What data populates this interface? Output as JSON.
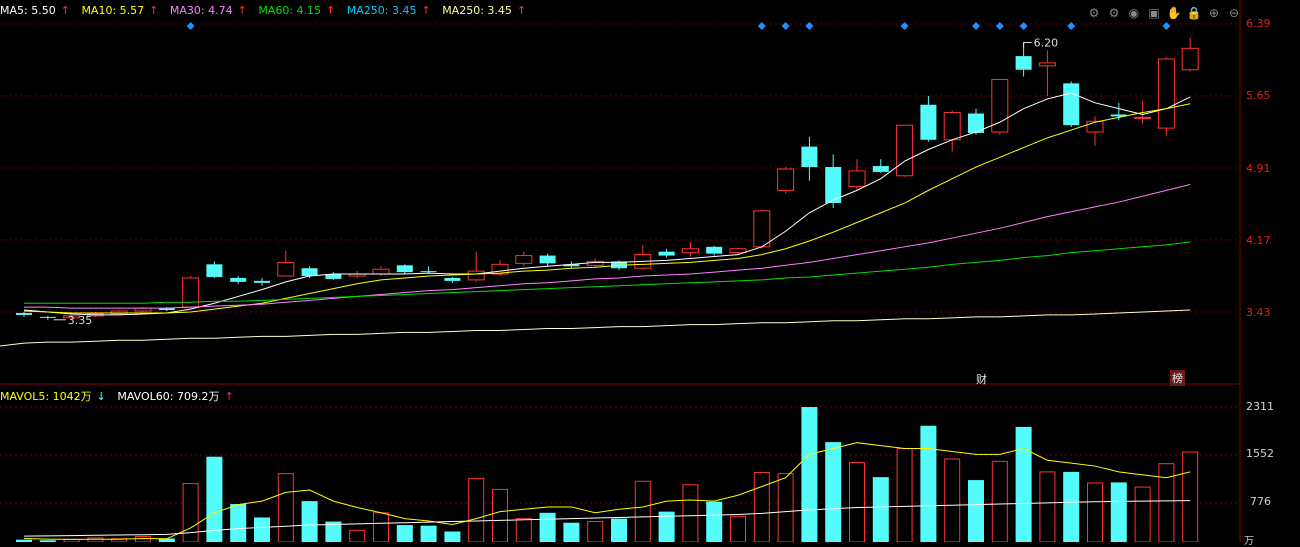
{
  "legend": {
    "ma5": {
      "label": "MA5: 5.50",
      "arrow": "↑",
      "color": "#ffffff"
    },
    "ma10": {
      "label": "MA10: 5.57",
      "arrow": "↑",
      "color": "#ffff00"
    },
    "ma30": {
      "label": "MA30: 4.74",
      "arrow": "↑",
      "color": "#ff80ff"
    },
    "ma60": {
      "label": "MA60: 4.15",
      "arrow": "↑",
      "color": "#00e000"
    },
    "ma250a": {
      "label": "MA250: 3.45",
      "arrow": "↑",
      "color": "#00ccff"
    },
    "ma250b": {
      "label": "MA250: 3.45",
      "arrow": "↑",
      "color": "#ffff99"
    }
  },
  "vol_legend": {
    "mavol5": {
      "label": "MAVOL5: 1042万",
      "arrow": "↓",
      "color": "#ffff00"
    },
    "mavol60": {
      "label": "MAVOL60: 709.2万",
      "arrow": "↑",
      "color": "#ffffff"
    }
  },
  "toolbar": [
    "gear-icon",
    "settings-icon",
    "eye-icon",
    "briefcase-icon",
    "hand-icon",
    "lock-icon",
    "zoom-in-icon",
    "zoom-out-icon"
  ],
  "toolbar_glyphs": [
    "⚙",
    "⚙",
    "◉",
    "▣",
    "✋",
    "🔒",
    "⊕",
    "⊖"
  ],
  "price_axis": [
    "6.39",
    "5.65",
    "4.91",
    "4.17",
    "3.43"
  ],
  "vol_axis": [
    "2311",
    "1552",
    "776"
  ],
  "annotations": {
    "high": "6.20",
    "low": "3.35",
    "cai": "财",
    "bang": "榜",
    "vol_unit": "万"
  },
  "colors": {
    "up": "#ff3232",
    "down": "#54fcfc",
    "grid": "#7a0000",
    "text": "#e0201e",
    "marker": "#1e90ff"
  },
  "chart_data": {
    "type": "candlestick",
    "price_range": [
      3.0,
      6.45
    ],
    "volume_range": [
      0,
      2400
    ],
    "candles": [
      {
        "o": 3.42,
        "c": 3.4,
        "h": 3.43,
        "l": 3.38,
        "v": 40,
        "up": false
      },
      {
        "o": 3.38,
        "c": 3.37,
        "h": 3.39,
        "l": 3.35,
        "v": 30,
        "up": false
      },
      {
        "o": 3.37,
        "c": 3.39,
        "h": 3.4,
        "l": 3.36,
        "v": 45,
        "up": true
      },
      {
        "o": 3.39,
        "c": 3.41,
        "h": 3.43,
        "l": 3.38,
        "v": 70,
        "up": true
      },
      {
        "o": 3.41,
        "c": 3.44,
        "h": 3.45,
        "l": 3.4,
        "v": 55,
        "up": true
      },
      {
        "o": 3.44,
        "c": 3.47,
        "h": 3.48,
        "l": 3.43,
        "v": 95,
        "up": true
      },
      {
        "o": 3.47,
        "c": 3.45,
        "h": 3.48,
        "l": 3.44,
        "v": 60,
        "up": false
      },
      {
        "o": 3.48,
        "c": 3.78,
        "h": 3.8,
        "l": 3.46,
        "v": 1000,
        "up": true
      },
      {
        "o": 3.92,
        "c": 3.79,
        "h": 3.95,
        "l": 3.78,
        "v": 1460,
        "up": false
      },
      {
        "o": 3.78,
        "c": 3.74,
        "h": 3.8,
        "l": 3.72,
        "v": 650,
        "up": false
      },
      {
        "o": 3.75,
        "c": 3.73,
        "h": 3.78,
        "l": 3.7,
        "v": 420,
        "up": false
      },
      {
        "o": 3.8,
        "c": 3.94,
        "h": 4.06,
        "l": 3.8,
        "v": 1170,
        "up": true
      },
      {
        "o": 3.88,
        "c": 3.8,
        "h": 3.9,
        "l": 3.78,
        "v": 700,
        "up": false
      },
      {
        "o": 3.82,
        "c": 3.77,
        "h": 3.84,
        "l": 3.76,
        "v": 350,
        "up": false
      },
      {
        "o": 3.8,
        "c": 3.82,
        "h": 3.85,
        "l": 3.78,
        "v": 200,
        "up": true
      },
      {
        "o": 3.82,
        "c": 3.87,
        "h": 3.9,
        "l": 3.8,
        "v": 500,
        "up": true
      },
      {
        "o": 3.91,
        "c": 3.84,
        "h": 3.92,
        "l": 3.82,
        "v": 290,
        "up": false
      },
      {
        "o": 3.85,
        "c": 3.84,
        "h": 3.9,
        "l": 3.83,
        "v": 280,
        "up": false
      },
      {
        "o": 3.78,
        "c": 3.75,
        "h": 3.79,
        "l": 3.73,
        "v": 180,
        "up": false
      },
      {
        "o": 3.76,
        "c": 3.85,
        "h": 4.05,
        "l": 3.74,
        "v": 1090,
        "up": true
      },
      {
        "o": 3.82,
        "c": 3.92,
        "h": 3.96,
        "l": 3.8,
        "v": 900,
        "up": true
      },
      {
        "o": 3.93,
        "c": 4.01,
        "h": 4.05,
        "l": 3.9,
        "v": 400,
        "up": true
      },
      {
        "o": 4.01,
        "c": 3.93,
        "h": 4.03,
        "l": 3.9,
        "v": 500,
        "up": false
      },
      {
        "o": 3.92,
        "c": 3.9,
        "h": 3.95,
        "l": 3.88,
        "v": 330,
        "up": false
      },
      {
        "o": 3.91,
        "c": 3.95,
        "h": 3.98,
        "l": 3.88,
        "v": 350,
        "up": true
      },
      {
        "o": 3.95,
        "c": 3.88,
        "h": 3.96,
        "l": 3.86,
        "v": 400,
        "up": false
      },
      {
        "o": 3.88,
        "c": 4.02,
        "h": 4.12,
        "l": 3.87,
        "v": 1040,
        "up": true
      },
      {
        "o": 4.05,
        "c": 4.01,
        "h": 4.08,
        "l": 3.99,
        "v": 520,
        "up": false
      },
      {
        "o": 4.04,
        "c": 4.08,
        "h": 4.15,
        "l": 4.0,
        "v": 980,
        "up": true
      },
      {
        "o": 4.1,
        "c": 4.03,
        "h": 4.11,
        "l": 4.01,
        "v": 690,
        "up": false
      },
      {
        "o": 4.04,
        "c": 4.08,
        "h": 4.09,
        "l": 4.02,
        "v": 440,
        "up": true
      },
      {
        "o": 4.1,
        "c": 4.47,
        "h": 4.48,
        "l": 4.08,
        "v": 1190,
        "up": true
      },
      {
        "o": 4.68,
        "c": 4.9,
        "h": 4.92,
        "l": 4.65,
        "v": 1170,
        "up": true
      },
      {
        "o": 5.13,
        "c": 4.92,
        "h": 5.23,
        "l": 4.78,
        "v": 2310,
        "up": false
      },
      {
        "o": 4.92,
        "c": 4.55,
        "h": 5.05,
        "l": 4.5,
        "v": 1710,
        "up": false
      },
      {
        "o": 4.72,
        "c": 4.88,
        "h": 5.0,
        "l": 4.68,
        "v": 1360,
        "up": true
      },
      {
        "o": 4.93,
        "c": 4.87,
        "h": 5.0,
        "l": 4.86,
        "v": 1110,
        "up": false
      },
      {
        "o": 4.83,
        "c": 5.35,
        "h": 5.35,
        "l": 4.82,
        "v": 1600,
        "up": true
      },
      {
        "o": 5.56,
        "c": 5.2,
        "h": 5.65,
        "l": 5.18,
        "v": 1990,
        "up": false
      },
      {
        "o": 5.2,
        "c": 5.48,
        "h": 5.5,
        "l": 5.08,
        "v": 1420,
        "up": true
      },
      {
        "o": 5.47,
        "c": 5.27,
        "h": 5.52,
        "l": 5.25,
        "v": 1060,
        "up": false
      },
      {
        "o": 5.28,
        "c": 5.82,
        "h": 5.82,
        "l": 5.25,
        "v": 1380,
        "up": true
      },
      {
        "o": 6.06,
        "c": 5.92,
        "h": 6.2,
        "l": 5.85,
        "v": 1970,
        "up": false
      },
      {
        "o": 5.96,
        "c": 5.99,
        "h": 6.12,
        "l": 5.65,
        "v": 1200,
        "up": true
      },
      {
        "o": 5.78,
        "c": 5.35,
        "h": 5.8,
        "l": 5.33,
        "v": 1200,
        "up": false
      },
      {
        "o": 5.28,
        "c": 5.39,
        "h": 5.44,
        "l": 5.14,
        "v": 1010,
        "up": true
      },
      {
        "o": 5.46,
        "c": 5.44,
        "h": 5.58,
        "l": 5.4,
        "v": 1020,
        "up": false
      },
      {
        "o": 5.42,
        "c": 5.43,
        "h": 5.6,
        "l": 5.36,
        "v": 940,
        "up": true
      },
      {
        "o": 5.32,
        "c": 6.03,
        "h": 6.05,
        "l": 5.24,
        "v": 1340,
        "up": true
      },
      {
        "o": 5.92,
        "c": 6.14,
        "h": 6.25,
        "l": 5.9,
        "v": 1540,
        "up": true
      }
    ],
    "ma_series": [
      {
        "name": "MA5",
        "color": "#ffffff",
        "values": [
          3.45,
          3.43,
          3.41,
          3.4,
          3.4,
          3.41,
          3.42,
          3.46,
          3.52,
          3.59,
          3.66,
          3.74,
          3.8,
          3.82,
          3.82,
          3.82,
          3.82,
          3.83,
          3.82,
          3.82,
          3.85,
          3.88,
          3.9,
          3.92,
          3.94,
          3.94,
          3.95,
          3.96,
          3.98,
          4.0,
          4.02,
          4.1,
          4.26,
          4.45,
          4.58,
          4.68,
          4.8,
          4.98,
          5.1,
          5.2,
          5.28,
          5.38,
          5.52,
          5.62,
          5.68,
          5.58,
          5.52,
          5.46,
          5.52,
          5.64
        ]
      },
      {
        "name": "MA10",
        "color": "#ffff00",
        "values": [
          3.44,
          3.43,
          3.42,
          3.42,
          3.42,
          3.42,
          3.42,
          3.43,
          3.46,
          3.49,
          3.52,
          3.57,
          3.62,
          3.67,
          3.72,
          3.76,
          3.78,
          3.8,
          3.81,
          3.82,
          3.83,
          3.85,
          3.86,
          3.88,
          3.89,
          3.91,
          3.92,
          3.93,
          3.94,
          3.96,
          3.98,
          4.02,
          4.08,
          4.16,
          4.25,
          4.35,
          4.45,
          4.55,
          4.68,
          4.8,
          4.92,
          5.02,
          5.12,
          5.22,
          5.3,
          5.38,
          5.43,
          5.48,
          5.52,
          5.57
        ]
      },
      {
        "name": "MA30",
        "color": "#ff80ff",
        "values": [
          3.48,
          3.48,
          3.47,
          3.47,
          3.47,
          3.47,
          3.47,
          3.48,
          3.49,
          3.5,
          3.51,
          3.53,
          3.55,
          3.57,
          3.59,
          3.61,
          3.63,
          3.65,
          3.66,
          3.68,
          3.7,
          3.72,
          3.73,
          3.75,
          3.77,
          3.78,
          3.8,
          3.81,
          3.82,
          3.84,
          3.86,
          3.88,
          3.91,
          3.94,
          3.98,
          4.02,
          4.06,
          4.1,
          4.14,
          4.19,
          4.24,
          4.29,
          4.35,
          4.41,
          4.46,
          4.51,
          4.56,
          4.62,
          4.68,
          4.74
        ]
      },
      {
        "name": "MA60",
        "color": "#00e000",
        "values": [
          3.52,
          3.52,
          3.52,
          3.52,
          3.52,
          3.52,
          3.53,
          3.53,
          3.54,
          3.54,
          3.55,
          3.56,
          3.57,
          3.58,
          3.59,
          3.6,
          3.61,
          3.62,
          3.63,
          3.64,
          3.65,
          3.66,
          3.67,
          3.68,
          3.69,
          3.7,
          3.71,
          3.72,
          3.73,
          3.74,
          3.75,
          3.76,
          3.78,
          3.79,
          3.81,
          3.83,
          3.85,
          3.87,
          3.89,
          3.92,
          3.94,
          3.96,
          3.99,
          4.01,
          4.04,
          4.06,
          4.08,
          4.1,
          4.12,
          4.15
        ]
      },
      {
        "name": "MA250",
        "color": "#ffffcc",
        "values": [
          3.11,
          3.12,
          3.12,
          3.13,
          3.14,
          3.14,
          3.15,
          3.16,
          3.16,
          3.17,
          3.18,
          3.18,
          3.19,
          3.2,
          3.2,
          3.21,
          3.22,
          3.22,
          3.23,
          3.24,
          3.24,
          3.25,
          3.26,
          3.26,
          3.27,
          3.28,
          3.28,
          3.29,
          3.3,
          3.3,
          3.31,
          3.32,
          3.32,
          3.33,
          3.34,
          3.34,
          3.35,
          3.36,
          3.36,
          3.37,
          3.38,
          3.38,
          3.39,
          3.4,
          3.4,
          3.41,
          3.42,
          3.43,
          3.44,
          3.45
        ]
      }
    ],
    "mavol_series": [
      {
        "name": "MAVOL5",
        "color": "#ffff00",
        "values": [
          60,
          50,
          45,
          48,
          48,
          60,
          55,
          240,
          500,
          640,
          700,
          850,
          890,
          700,
          590,
          500,
          400,
          360,
          300,
          400,
          520,
          560,
          600,
          600,
          500,
          560,
          600,
          700,
          720,
          700,
          800,
          950,
          1100,
          1500,
          1600,
          1700,
          1650,
          1600,
          1600,
          1550,
          1500,
          1500,
          1600,
          1400,
          1350,
          1300,
          1200,
          1150,
          1100,
          1200
        ]
      },
      {
        "name": "MAVOL60",
        "color": "#ffffff",
        "values": [
          100,
          105,
          110,
          115,
          120,
          125,
          130,
          160,
          200,
          230,
          250,
          270,
          290,
          300,
          310,
          320,
          330,
          340,
          350,
          360,
          370,
          380,
          390,
          400,
          410,
          420,
          430,
          440,
          450,
          460,
          470,
          490,
          520,
          550,
          570,
          590,
          600,
          610,
          620,
          630,
          640,
          650,
          660,
          670,
          680,
          690,
          695,
          700,
          705,
          709
        ]
      }
    ],
    "markers": [
      7,
      31,
      32,
      33,
      37,
      40,
      41,
      42,
      44,
      48
    ]
  }
}
